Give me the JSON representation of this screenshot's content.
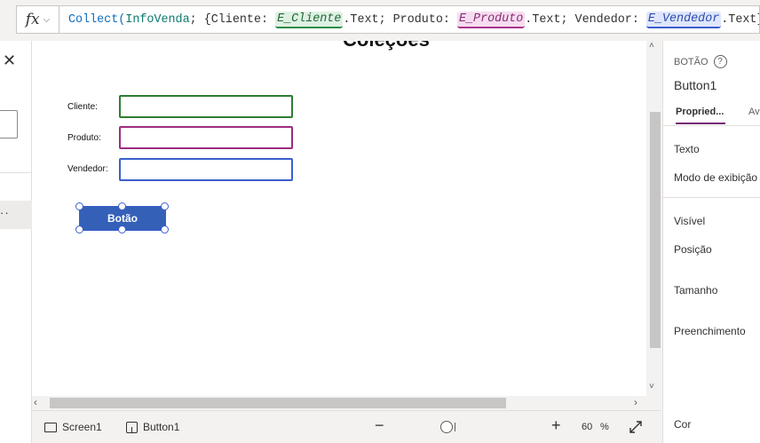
{
  "formula_bar": {
    "fx_label": "fx",
    "tokens": {
      "t1": "Collect(",
      "t2": "InfoVenda",
      "t3": "; {Cliente: ",
      "t4": "E_Cliente",
      "t5": ".Text; Produto: ",
      "t6": "E_Produto",
      "t7": ".Text; Vendedor: ",
      "t8": "E_Vendedor",
      "t9": ".Text})"
    }
  },
  "canvas": {
    "title": "Coleções",
    "labels": {
      "cliente": "Cliente:",
      "produto": "Produto:",
      "vendedor": "Vendedor:"
    },
    "button_label": "Botão"
  },
  "status_bar": {
    "screen_crumb": "Screen1",
    "control_crumb": "Button1",
    "zoom_value": "60",
    "zoom_unit": "%"
  },
  "properties_panel": {
    "control_type": "BOTÃO",
    "control_name": "Button1",
    "tabs": [
      "Propried...",
      "Ava"
    ],
    "properties": [
      "Texto",
      "Modo de exibição",
      "Visível",
      "Posição",
      "Tamanho",
      "Preenchimento",
      "Cor"
    ]
  },
  "colors": {
    "cliente_border": "#2e7d32",
    "produto_border": "#9c2d82",
    "vendedor_border": "#3a5fcd",
    "button_fill": "#3460b8",
    "active_tab_accent": "#742774"
  },
  "icons": [
    "fx-icon",
    "chevron-down-icon",
    "close-icon",
    "more-icon",
    "screen-icon",
    "button-control-icon",
    "zoom-out-icon",
    "zoom-in-icon",
    "fit-to-window-icon",
    "help-icon"
  ]
}
